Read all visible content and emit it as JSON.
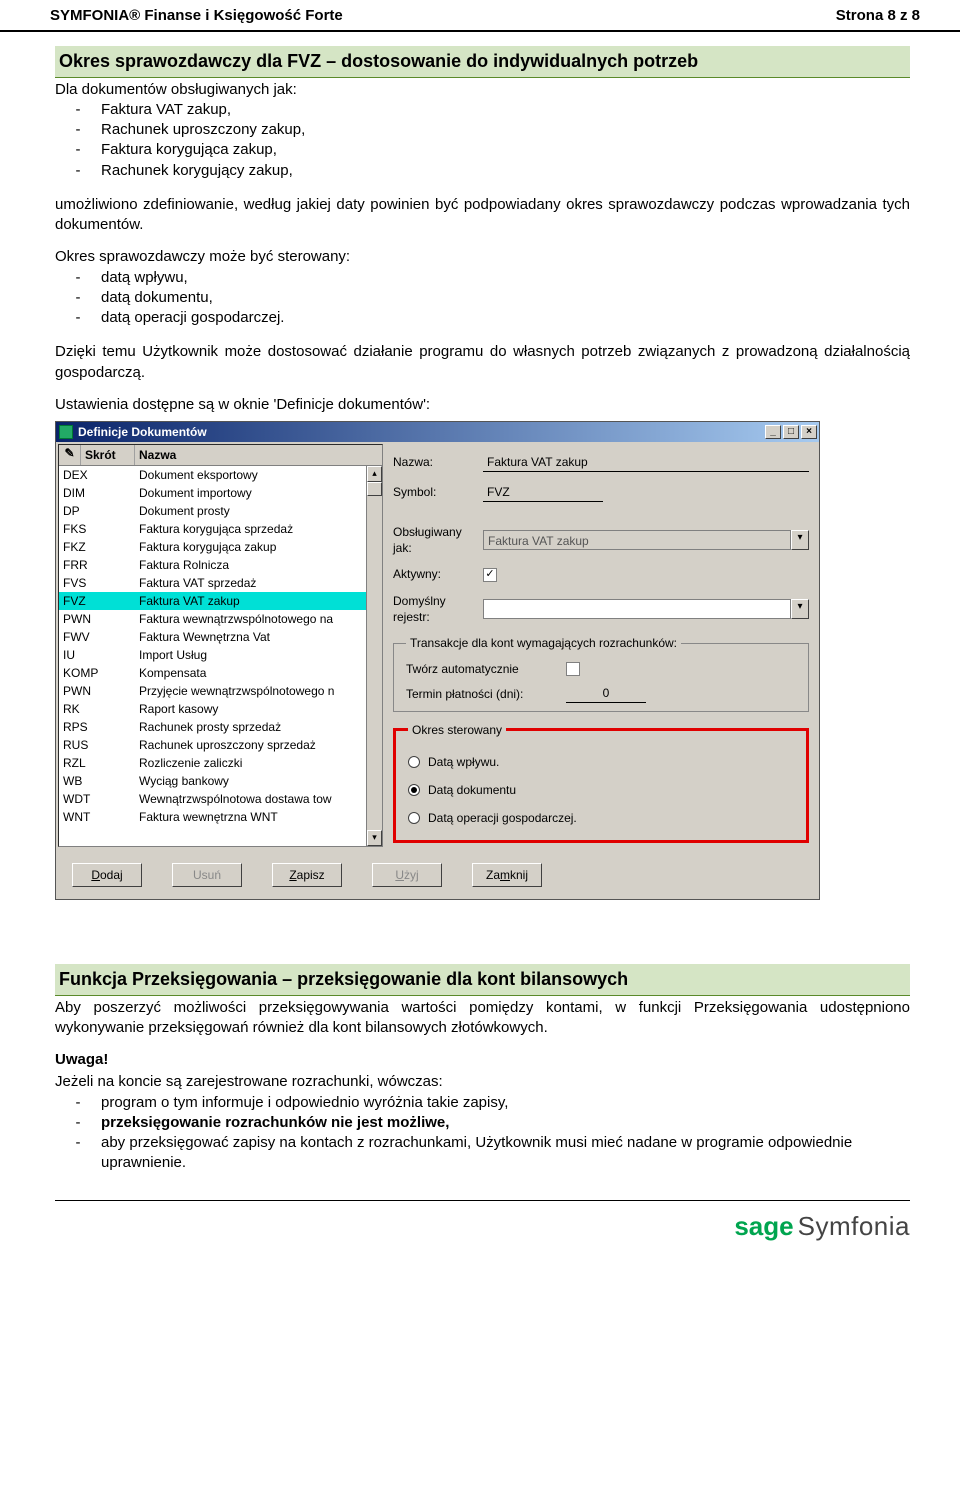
{
  "header": {
    "product": "SYMFONIA® Finanse i Księgowość Forte",
    "page": "Strona 8 z 8"
  },
  "section1": {
    "title": "Okres sprawozdawczy dla FVZ – dostosowanie do indywidualnych potrzeb",
    "intro": "Dla dokumentów obsługiwanych jak:",
    "list1": [
      "Faktura VAT zakup,",
      "Rachunek uproszczony zakup,",
      "Faktura korygująca zakup,",
      "Rachunek korygujący zakup,"
    ],
    "p1": "umożliwiono zdefiniowanie, według jakiej daty powinien być podpowiadany okres sprawozdawczy podczas wprowadzania tych dokumentów.",
    "p2intro": "Okres sprawozdawczy może być sterowany:",
    "list2": [
      "datą wpływu,",
      "datą dokumentu,",
      "datą operacji gospodarczej."
    ],
    "p3": "Dzięki temu Użytkownik może dostosować działanie programu do własnych potrzeb związanych z prowadzoną działalnością gospodarczą.",
    "p4": "Ustawienia dostępne są w oknie 'Definicje dokumentów':"
  },
  "app": {
    "title": "Definicje Dokumentów",
    "table": {
      "col_edit": "✎",
      "col_short": "Skrót",
      "col_name": "Nazwa",
      "rows": [
        {
          "s": "DEX",
          "n": "Dokument eksportowy"
        },
        {
          "s": "DIM",
          "n": "Dokument importowy"
        },
        {
          "s": "DP",
          "n": "Dokument prosty"
        },
        {
          "s": "FKS",
          "n": "Faktura korygująca sprzedaż"
        },
        {
          "s": "FKZ",
          "n": "Faktura korygująca zakup"
        },
        {
          "s": "FRR",
          "n": "Faktura Rolnicza"
        },
        {
          "s": "FVS",
          "n": "Faktura VAT sprzedaż"
        },
        {
          "s": "FVZ",
          "n": "Faktura VAT zakup",
          "selected": true
        },
        {
          "s": "PWN",
          "n": "Faktura wewnątrzwspólnotowego na"
        },
        {
          "s": "FWV",
          "n": "Faktura Wewnętrzna Vat"
        },
        {
          "s": "IU",
          "n": "Import Usług"
        },
        {
          "s": "KOMP",
          "n": "Kompensata"
        },
        {
          "s": "PWN",
          "n": "Przyjęcie wewnątrzwspólnotowego n"
        },
        {
          "s": "RK",
          "n": "Raport kasowy"
        },
        {
          "s": "RPS",
          "n": "Rachunek prosty sprzedaż"
        },
        {
          "s": "RUS",
          "n": "Rachunek uproszczony sprzedaż"
        },
        {
          "s": "RZL",
          "n": "Rozliczenie zaliczki"
        },
        {
          "s": "WB",
          "n": "Wyciąg bankowy"
        },
        {
          "s": "WDT",
          "n": "Wewnątrzwspólnotowa dostawa tow"
        },
        {
          "s": "WNT",
          "n": "Faktura wewnętrzna WNT"
        }
      ]
    },
    "form": {
      "name_label": "Nazwa:",
      "name_value": "Faktura VAT zakup",
      "symbol_label": "Symbol:",
      "symbol_value": "FVZ",
      "handled_label": "Obsługiwany jak:",
      "handled_value": "Faktura VAT zakup",
      "active_label": "Aktywny:",
      "active_checked": "✓",
      "defreg_label": "Domyślny rejestr:",
      "group1_legend": "Transakcje dla kont wymagających rozrachunków:",
      "group1_auto": "Twórz automatycznie",
      "group1_term": "Termin płatności (dni):",
      "group1_term_value": "0",
      "group2_legend": "Okres sterowany",
      "radio1": "Datą wpływu.",
      "radio2": "Datą dokumentu",
      "radio3": "Datą operacji gospodarczej."
    },
    "buttons": {
      "add": "Dodaj",
      "del": "Usuń",
      "save": "Zapisz",
      "use": "Użyj",
      "close": "Zamknij"
    }
  },
  "section2": {
    "title": "Funkcja Przeksięgowania – przeksięgowanie dla kont bilansowych",
    "p1": "Aby poszerzyć możliwości przeksięgowywania wartości pomiędzy kontami, w funkcji Przeksięgowania udostępniono wykonywanie przeksięgowań również dla kont bilansowych złotówkowych.",
    "warn_label": "Uwaga!",
    "warn_intro": "Jeżeli na koncie są zarejestrowane rozrachunki, wówczas:",
    "list": [
      {
        "text": "program o tym informuje i odpowiednio wyróżnia takie zapisy,",
        "bold": false
      },
      {
        "text": "przeksięgowanie rozrachunków nie jest możliwe,",
        "bold": true
      },
      {
        "text": "aby przeksięgować zapisy na kontach z rozrachunkami, Użytkownik musi mieć nadane w programie odpowiednie uprawnienie.",
        "bold": false
      }
    ]
  },
  "footer": {
    "sage": "sage",
    "sym": "Symfonia"
  }
}
